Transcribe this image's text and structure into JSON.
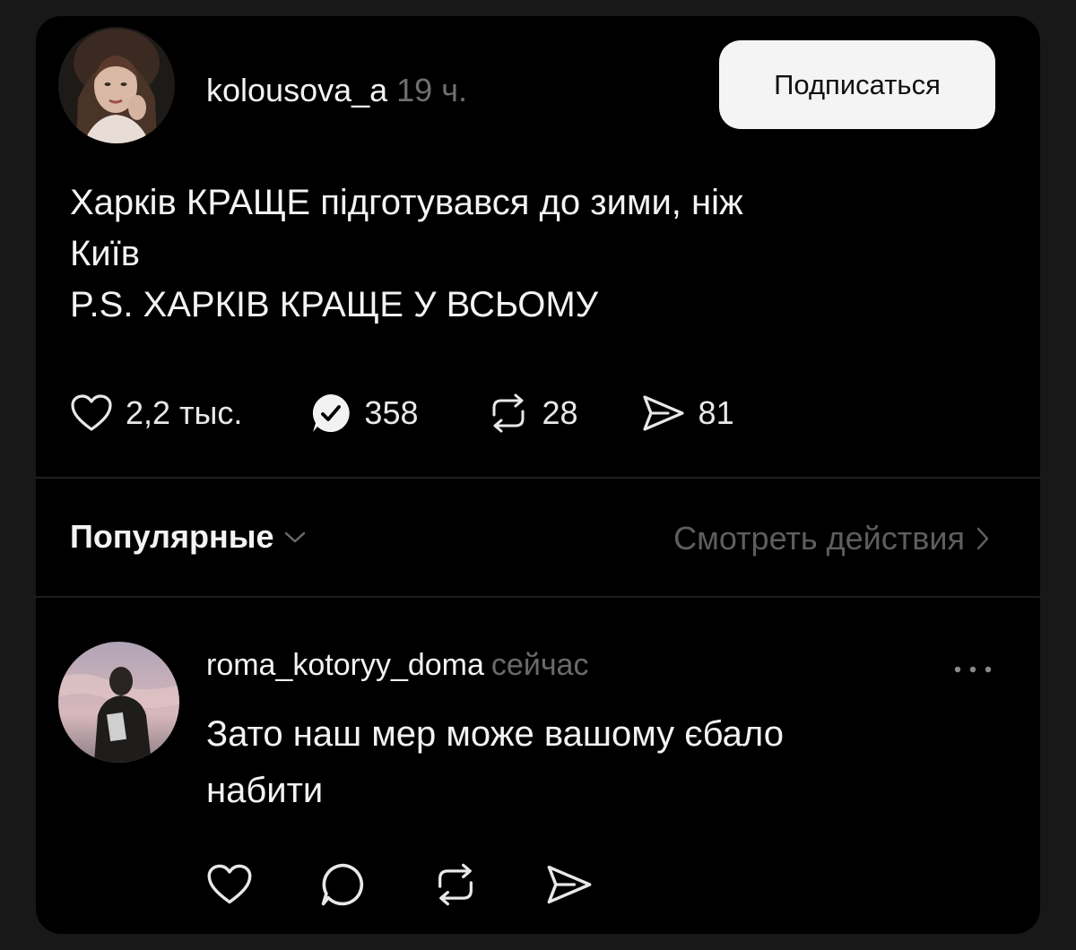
{
  "post": {
    "username": "kolousova_a",
    "time": "19 ч.",
    "follow_label": "Подписаться",
    "text_lines": [
      "Харків КРАЩЕ підготувався до зими, ніж",
      "Київ",
      "P.S. ХАРКІВ КРАЩЕ У ВСЬОМУ"
    ],
    "stats": {
      "likes": "2,2 тыс.",
      "replies": "358",
      "reposts": "28",
      "shares": "81"
    }
  },
  "filter": {
    "sort_label": "Популярные",
    "view_activity_label": "Смотреть действия"
  },
  "reply": {
    "username": "roma_kotoryy_doma",
    "time": "сейчас",
    "text_lines": [
      "Зато наш мер може вашому єбало",
      "набити"
    ]
  },
  "icons": {
    "heart": "heart-icon",
    "reply": "reply-check-icon",
    "repost": "repost-icon",
    "share": "share-icon",
    "more": "more-icon"
  },
  "colors": {
    "background": "#000000",
    "text": "#f3f3f3",
    "muted": "#6f6f6f",
    "button_bg": "#f4f4f4"
  }
}
